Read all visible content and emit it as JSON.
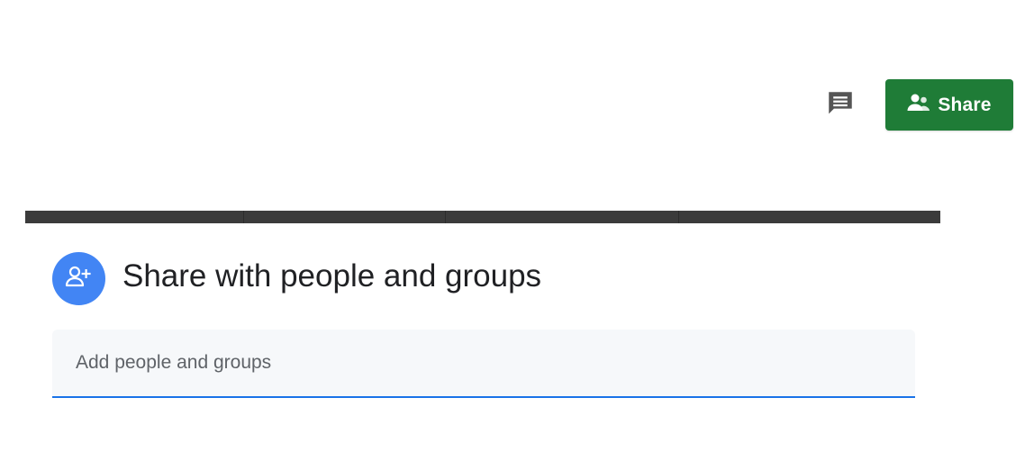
{
  "toolbar": {
    "comment_icon": "comment-icon",
    "share_button": {
      "label": "Share",
      "icon": "people-icon",
      "color": "#1f7c37"
    }
  },
  "dialog": {
    "avatar_icon": "add-person-icon",
    "avatar_color": "#4285f4",
    "title": "Share with people and groups",
    "input": {
      "placeholder": "Add people and groups",
      "value": "",
      "underline_color": "#1a73e8"
    }
  }
}
